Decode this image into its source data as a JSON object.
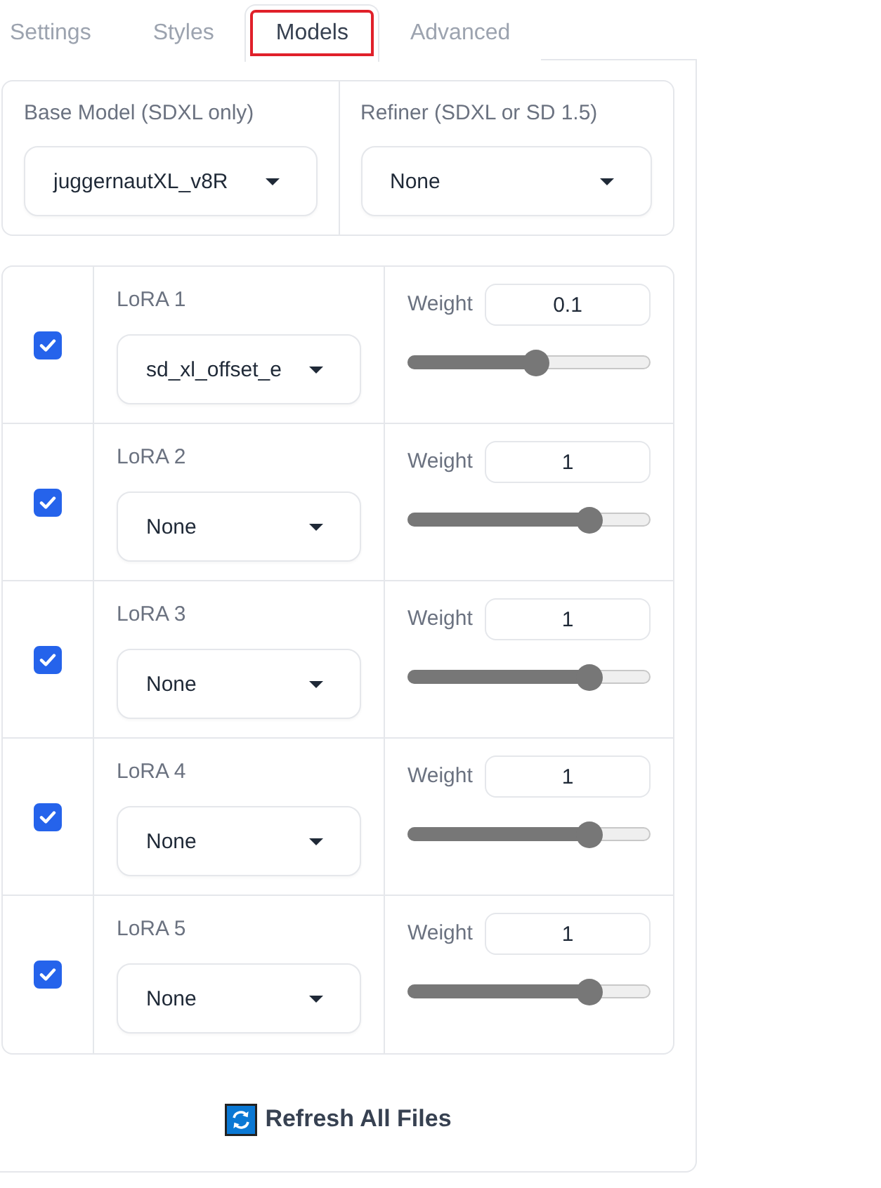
{
  "tabs": [
    {
      "label": "Settings",
      "selected": false,
      "highlighted": false
    },
    {
      "label": "Styles",
      "selected": false,
      "highlighted": false
    },
    {
      "label": "Models",
      "selected": true,
      "highlighted": true
    },
    {
      "label": "Advanced",
      "selected": false,
      "highlighted": false
    }
  ],
  "model_selects": [
    {
      "label": "Base Model (SDXL only)",
      "value": "juggernautXL_v8R"
    },
    {
      "label": "Refiner (SDXL or SD 1.5)",
      "value": "None"
    }
  ],
  "loras": [
    {
      "enabled": true,
      "label": "LoRA 1",
      "model": "sd_xl_offset_e",
      "weight_label": "Weight",
      "weight": "0.1",
      "level": 0.525
    },
    {
      "enabled": true,
      "label": "LoRA 2",
      "model": "None",
      "weight_label": "Weight",
      "weight": "1",
      "level": 0.75
    },
    {
      "enabled": true,
      "label": "LoRA 3",
      "model": "None",
      "weight_label": "Weight",
      "weight": "1",
      "level": 0.75
    },
    {
      "enabled": true,
      "label": "LoRA 4",
      "model": "None",
      "weight_label": "Weight",
      "weight": "1",
      "level": 0.75
    },
    {
      "enabled": true,
      "label": "LoRA 5",
      "model": "None",
      "weight_label": "Weight",
      "weight": "1",
      "level": 0.75
    }
  ],
  "refresh_button": {
    "label": "Refresh All Files"
  }
}
